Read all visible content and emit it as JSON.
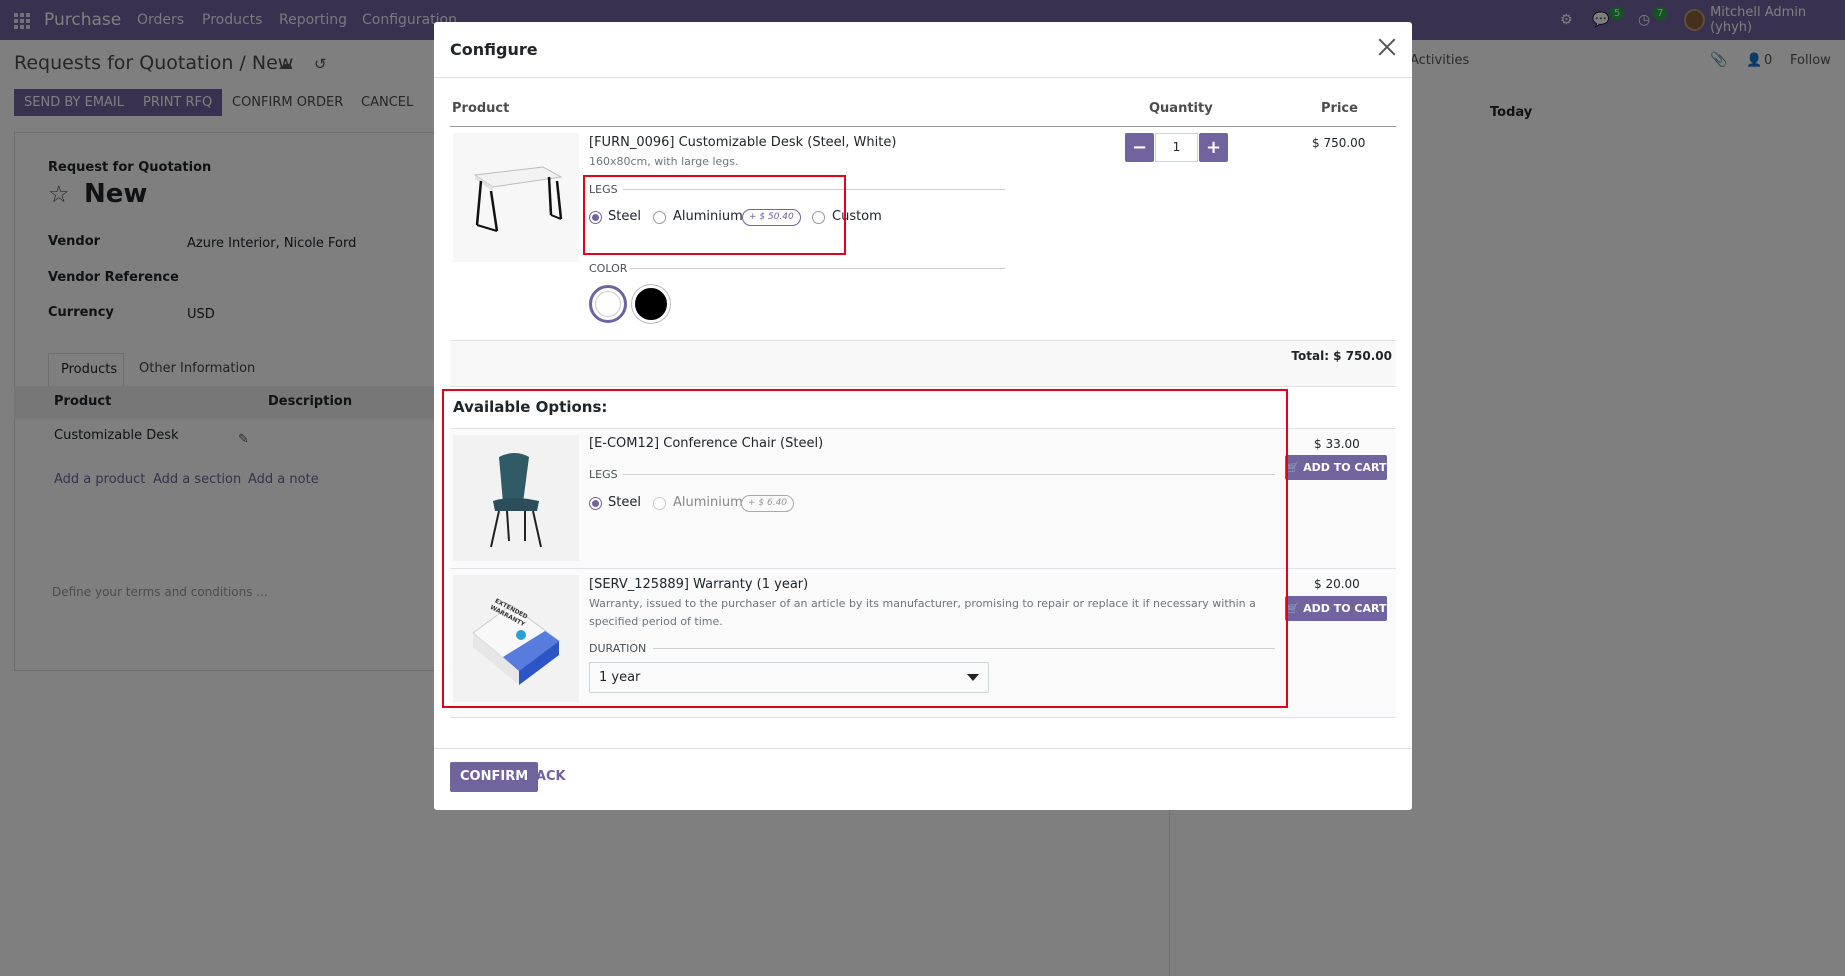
{
  "navbar": {
    "brand": "Purchase",
    "menu": [
      "Orders",
      "Products",
      "Reporting",
      "Configuration"
    ],
    "messages_count": "5",
    "activities_count": "7",
    "user": "Mitchell Admin (yhyh)"
  },
  "background": {
    "breadcrumb": "Requests for Quotation / New",
    "buttons": [
      "SEND BY EMAIL",
      "PRINT RFQ",
      "CONFIRM ORDER",
      "CANCEL"
    ],
    "form_title_small": "Request for Quotation",
    "form_title": "New",
    "fields": [
      {
        "label": "Vendor",
        "value": "Azure Interior, Nicole Ford"
      },
      {
        "label": "Vendor Reference",
        "value": ""
      },
      {
        "label": "Currency",
        "value": "USD"
      }
    ],
    "tabs": [
      "Products",
      "Other Information"
    ],
    "table_headers": [
      "Product",
      "Description"
    ],
    "line_product": "Customizable Desk",
    "add_links": [
      "Add a product",
      "Add a section",
      "Add a note"
    ],
    "terms_placeholder": "Define your terms and conditions ...",
    "chatter": {
      "activities": "Activities",
      "followers": "0",
      "follow": "Follow",
      "today": "Today"
    }
  },
  "modal": {
    "title": "Configure",
    "headers": {
      "product": "Product",
      "quantity": "Quantity",
      "price": "Price"
    },
    "main_product": {
      "name": "[FURN_0096] Customizable Desk (Steel, White)",
      "description": "160x80cm, with large legs.",
      "quantity": "1",
      "price": "$ 750.00",
      "legs_label": "LEGS",
      "legs_options": [
        "Steel",
        "Aluminium",
        "Custom"
      ],
      "legs_selected": "Steel",
      "aluminium_extra": "+ $ 50.40",
      "color_label": "COLOR",
      "colors": [
        "#ffffff",
        "#000000"
      ],
      "color_selected": "White"
    },
    "total": "Total: $ 750.00",
    "options_title": "Available Options:",
    "options": [
      {
        "name": "[E-COM12] Conference Chair (Steel)",
        "price": "$ 33.00",
        "attr_label": "LEGS",
        "legs_options": [
          "Steel",
          "Aluminium"
        ],
        "legs_selected": "Steel",
        "aluminium_extra": "+ $ 6.40",
        "button": "ADD TO CART"
      },
      {
        "name": "[SERV_125889] Warranty (1 year)",
        "description": "Warranty, issued to the purchaser of an article by its manufacturer, promising to repair or replace it if necessary within a specified period of time.",
        "price": "$ 20.00",
        "attr_label": "DURATION",
        "duration_value": "1 year",
        "button": "ADD TO CART",
        "image_text": "EXTENDED WARRANTY"
      }
    ],
    "footer": {
      "confirm": "CONFIRM",
      "back": "BACK"
    }
  },
  "accent_color": "#71639e",
  "highlight_color": "#e3001b"
}
